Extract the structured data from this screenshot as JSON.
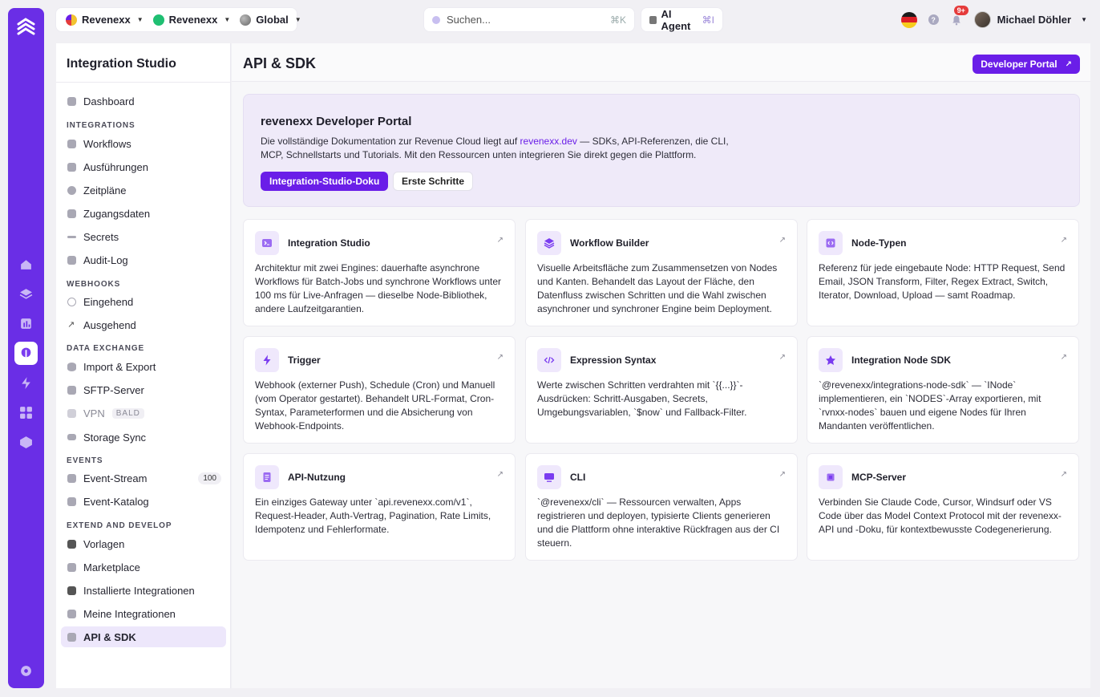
{
  "topbar": {
    "workspaces": [
      {
        "label": "Revenexx",
        "icon": "brand-dot-icon"
      },
      {
        "label": "Revenexx",
        "icon": "green-dot-icon"
      },
      {
        "label": "Global",
        "icon": "globe-icon"
      }
    ],
    "search_placeholder": "Suchen...",
    "search_shortcut": "⌘K",
    "agent_label": "AI Agent",
    "agent_shortcut": "⌘I",
    "notification_badge": "9+",
    "help_label": "?",
    "user_name": "Michael Döhler"
  },
  "sidebar": {
    "title": "Integration Studio",
    "items": [
      {
        "label": "Dashboard"
      },
      {
        "label": "Workflows"
      },
      {
        "label": "Ausführungen"
      },
      {
        "label": "Zeitpläne"
      },
      {
        "label": "Zugangsdaten"
      },
      {
        "label": "Secrets"
      },
      {
        "label": "Audit-Log"
      },
      {
        "label": "Eingehend"
      },
      {
        "label": "Ausgehend"
      },
      {
        "label": "Import & Export"
      },
      {
        "label": "SFTP-Server"
      },
      {
        "label": "VPN",
        "badge": "BALD"
      },
      {
        "label": "Storage Sync"
      },
      {
        "label": "Event-Stream",
        "count": "100"
      },
      {
        "label": "Event-Katalog"
      },
      {
        "label": "Vorlagen"
      },
      {
        "label": "Marketplace"
      },
      {
        "label": "Installierte Integrationen"
      },
      {
        "label": "Meine Integrationen"
      },
      {
        "label": "API & SDK"
      }
    ],
    "sections": [
      "INTEGRATIONS",
      "WEBHOOKS",
      "DATA EXCHANGE",
      "EVENTS",
      "EXTEND AND DEVELOP"
    ]
  },
  "main": {
    "title": "API & SDK",
    "developer_portal_button": "Developer Portal",
    "hero": {
      "title": "revenexx Developer Portal",
      "text_before_link": "Die vollständige Dokumentation zur Revenue Cloud liegt auf ",
      "link": "revenexx.dev",
      "text_after_link": " — SDKs, API-Referenzen, die CLI, MCP, Schnellstarts und Tutorials. Mit den Ressourcen unten integrieren Sie direkt gegen die Plattform.",
      "primary_button": "Integration-Studio-Doku",
      "secondary_button": "Erste Schritte"
    },
    "cards": [
      {
        "title": "Integration Studio",
        "icon": "terminal-icon",
        "desc": "Architektur mit zwei Engines: dauerhafte asynchrone Workflows für Batch-Jobs und synchrone Workflows unter 100 ms für Live-Anfragen — dieselbe Node-Bibliothek, andere Laufzeitgarantien."
      },
      {
        "title": "Workflow Builder",
        "icon": "layers-icon",
        "desc": "Visuelle Arbeitsfläche zum Zusammensetzen von Nodes und Kanten. Behandelt das Layout der Fläche, den Datenfluss zwischen Schritten und die Wahl zwischen asynchroner und synchroner Engine beim Deployment."
      },
      {
        "title": "Node-Typen",
        "icon": "code-file-icon",
        "desc": "Referenz für jede eingebaute Node: HTTP Request, Send Email, JSON Transform, Filter, Regex Extract, Switch, Iterator, Download, Upload — samt Roadmap."
      },
      {
        "title": "Trigger",
        "icon": "lightning-icon",
        "desc": "Webhook (externer Push), Schedule (Cron) und Manuell (vom Operator gestartet). Behandelt URL-Format, Cron-Syntax, Parameterformen und die Absicherung von Webhook-Endpoints."
      },
      {
        "title": "Expression Syntax",
        "icon": "code-icon",
        "desc": "Werte zwischen Schritten verdrahten mit `{{...}}`-Ausdrücken: Schritt-Ausgaben, Secrets, Umgebungsvariablen, `$now` und Fallback-Filter."
      },
      {
        "title": "Integration Node SDK",
        "icon": "puzzle-icon",
        "desc": "`@revenexx/integrations-node-sdk` — `INode` implementieren, ein `NODES`-Array exportieren, mit `rvnxx-nodes` bauen und eigene Nodes für Ihren Mandanten veröffentlichen."
      },
      {
        "title": "API-Nutzung",
        "icon": "document-icon",
        "desc": "Ein einziges Gateway unter `api.revenexx.com/v1`, Request-Header, Auth-Vertrag, Pagination, Rate Limits, Idempotenz und Fehlerformate."
      },
      {
        "title": "CLI",
        "icon": "monitor-icon",
        "desc": "`@revenexx/cli` — Ressourcen verwalten, Apps registrieren und deployen, typisierte Clients generieren und die Plattform ohne interaktive Rückfragen aus der CI steuern."
      },
      {
        "title": "MCP-Server",
        "icon": "chip-icon",
        "desc": "Verbinden Sie Claude Code, Cursor, Windsurf oder VS Code über das Model Context Protocol mit der revenexx-API und -Doku, für kontextbewusste Codegenerierung."
      }
    ]
  },
  "colors": {
    "brand": "#6a1ee8",
    "rail": "#6a2ee6",
    "accent_soft": "#efe8fc"
  }
}
